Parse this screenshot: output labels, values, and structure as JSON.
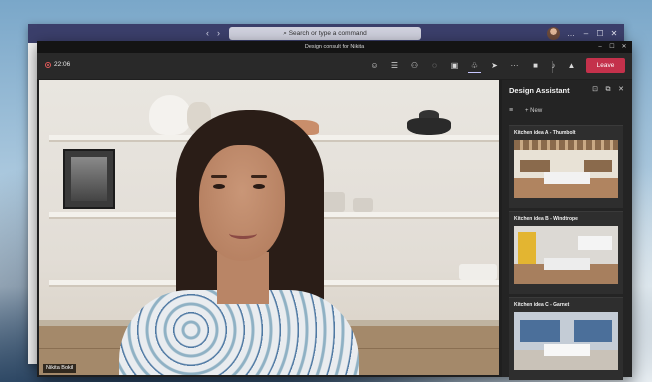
{
  "back_window": {
    "search_placeholder": "Search or type a command",
    "nav_back": "‹",
    "nav_forward": "›",
    "controls": [
      "…",
      "–",
      "☐",
      "✕"
    ]
  },
  "window": {
    "title": "Design consult for Nikita",
    "controls": [
      "–",
      "☐",
      "✕"
    ]
  },
  "toolbar": {
    "recording_time": "22:06",
    "icons": [
      "reactions-icon",
      "chat-list-icon",
      "participants-icon",
      "chat-icon",
      "rooms-icon",
      "apps-icon",
      "share-icon",
      "more-icon",
      "camera-icon",
      "mic-icon",
      "share-tray-icon"
    ],
    "icon_glyphs": [
      "☺",
      "☰",
      "⚇",
      "◌",
      "▣",
      "♧",
      "➤",
      "···",
      "■",
      "♪",
      "▲"
    ],
    "leave_label": "Leave"
  },
  "video": {
    "participant_name": "Nikita Bokil"
  },
  "panel": {
    "title": "Design Assistant",
    "menu_glyph": "≡",
    "new_label": "+ New",
    "header_icons": [
      "⊡",
      "⧉",
      "✕"
    ],
    "cards": [
      {
        "title": "Kitchen idea A - Thumbolt",
        "wall": "#e8e2d6",
        "floor": "#b08460",
        "cabinet": "#8a6a4c"
      },
      {
        "title": "Kitchen idea B - Windtrope",
        "wall": "#dcd9d4",
        "floor": "#a77f5e",
        "cabinet": "#e3b531"
      },
      {
        "title": "Kitchen idea C - Garnet",
        "wall": "#c4ccd6",
        "floor": "#c9c2b8",
        "cabinet": "#4b6f9a"
      }
    ]
  }
}
